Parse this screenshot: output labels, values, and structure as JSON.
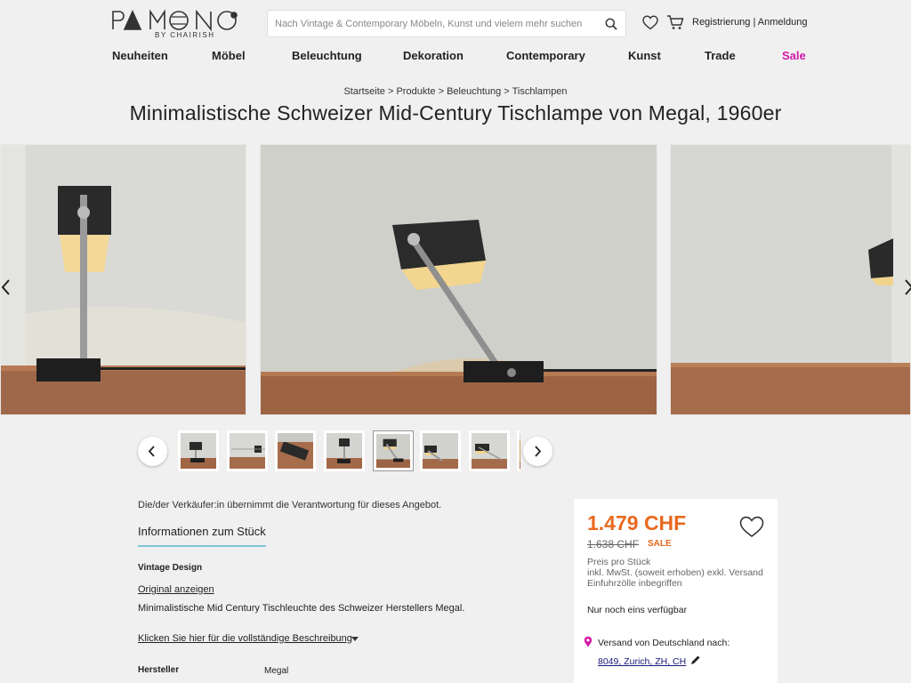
{
  "brand": {
    "name": "PAMONO",
    "sub": "BY CHAIRISH"
  },
  "search": {
    "placeholder": "Nach Vintage & Contemporary Möbeln, Kunst und vielem mehr suchen"
  },
  "auth": {
    "register": "Registrierung",
    "separator": "|",
    "login": "Anmeldung"
  },
  "nav": [
    {
      "label": "Neuheiten"
    },
    {
      "label": "Möbel"
    },
    {
      "label": "Beleuchtung"
    },
    {
      "label": "Dekoration"
    },
    {
      "label": "Contemporary"
    },
    {
      "label": "Kunst"
    },
    {
      "label": "Trade"
    },
    {
      "label": "Sale"
    }
  ],
  "breadcrumb": [
    "Startseite",
    "Produkte",
    "Beleuchtung",
    "Tischlampen"
  ],
  "breadcrumb_sep": ">",
  "title": "Minimalistische Schweizer Mid-Century Tischlampe von Megal, 1960er",
  "colors": {
    "accent_orange": "#e8691f",
    "sale_magenta": "#d21aa8",
    "tab_underline": "#7fc6d6"
  },
  "gallery": {
    "thumb_count": 8,
    "active_thumb": 5
  },
  "seller_note": "Die/der Verkäufer:in übernimmt die Verantwortung für dieses Angebot.",
  "info_tab": "Informationen zum Stück",
  "vintage_label": "Vintage Design",
  "original_link": "Original anzeigen",
  "description": "Minimalistische Mid Century Tischleuchte des Schweizer Herstellers Megal.",
  "more_link": "Klicken Sie hier für die vollständige Beschreibung",
  "specs": {
    "key": "Hersteller",
    "value": "Megal"
  },
  "price": {
    "current": "1.479 CHF",
    "old": "1.638 CHF",
    "sale": "SALE",
    "per_piece": "Preis pro Stück",
    "vat": "inkl. MwSt. (soweit erhoben) exkl. Versand",
    "duties": "Einfuhrzölle inbegriffen",
    "stock": "Nur noch eins verfügbar",
    "ship_label": "Versand von Deutschland nach:",
    "ship_dest": "8049, Zurich, ZH, CH"
  }
}
